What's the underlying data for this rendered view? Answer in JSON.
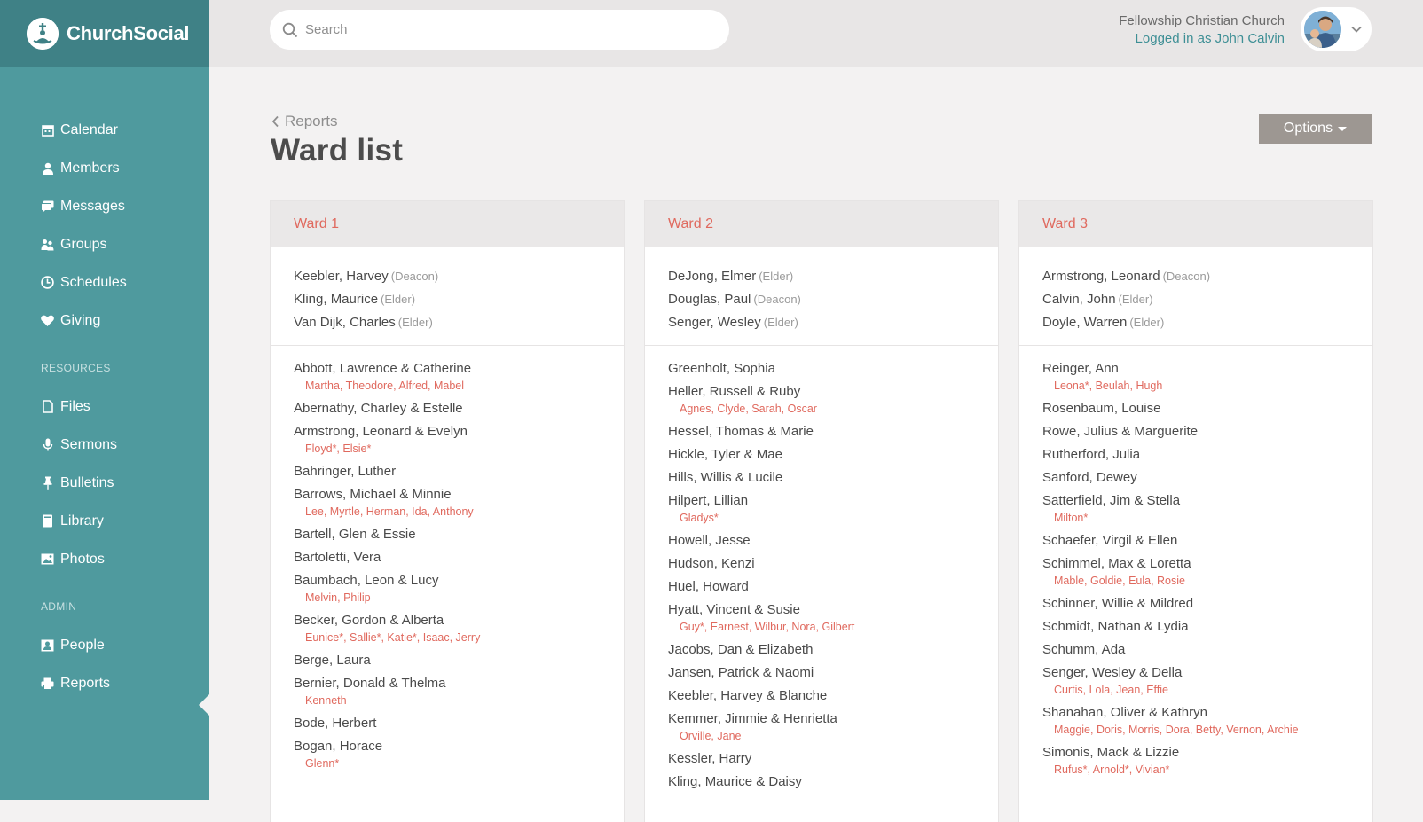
{
  "brand": {
    "name": "ChurchSocial"
  },
  "search": {
    "placeholder": "Search"
  },
  "header": {
    "church_name": "Fellowship Christian Church",
    "login_text": "Logged in as John Calvin"
  },
  "sidebar": {
    "main_items": [
      {
        "label": "Calendar",
        "icon": "calendar-icon"
      },
      {
        "label": "Members",
        "icon": "person-icon"
      },
      {
        "label": "Messages",
        "icon": "chat-icon"
      },
      {
        "label": "Groups",
        "icon": "group-icon"
      },
      {
        "label": "Schedules",
        "icon": "clock-icon"
      },
      {
        "label": "Giving",
        "icon": "heart-icon"
      }
    ],
    "resources_heading": "RESOURCES",
    "resource_items": [
      {
        "label": "Files",
        "icon": "file-icon"
      },
      {
        "label": "Sermons",
        "icon": "microphone-icon"
      },
      {
        "label": "Bulletins",
        "icon": "pin-icon"
      },
      {
        "label": "Library",
        "icon": "book-icon"
      },
      {
        "label": "Photos",
        "icon": "image-icon"
      }
    ],
    "admin_heading": "ADMIN",
    "admin_items": [
      {
        "label": "People",
        "icon": "contact-card-icon"
      },
      {
        "label": "Reports",
        "icon": "printer-icon",
        "active": true
      }
    ]
  },
  "page": {
    "back_label": "Reports",
    "title": "Ward list",
    "options_label": "Options"
  },
  "colors": {
    "accent": "#e0695e",
    "sidebar": "#4f9a9e",
    "teal_text": "#3e8f95"
  },
  "wards": [
    {
      "title": "Ward 1",
      "leaders": [
        {
          "name": "Keebler, Harvey",
          "role": "(Deacon)"
        },
        {
          "name": "Kling, Maurice",
          "role": "(Elder)"
        },
        {
          "name": "Van Dijk, Charles",
          "role": "(Elder)"
        }
      ],
      "households": [
        {
          "name": "Abbott, Lawrence & Catherine",
          "children": "Martha, Theodore, Alfred, Mabel"
        },
        {
          "name": "Abernathy, Charley & Estelle",
          "children": ""
        },
        {
          "name": "Armstrong, Leonard & Evelyn",
          "children": "Floyd*, Elsie*"
        },
        {
          "name": "Bahringer, Luther",
          "children": ""
        },
        {
          "name": "Barrows, Michael & Minnie",
          "children": "Lee, Myrtle, Herman, Ida, Anthony"
        },
        {
          "name": "Bartell, Glen & Essie",
          "children": ""
        },
        {
          "name": "Bartoletti, Vera",
          "children": ""
        },
        {
          "name": "Baumbach, Leon & Lucy",
          "children": "Melvin, Philip"
        },
        {
          "name": "Becker, Gordon & Alberta",
          "children": "Eunice*, Sallie*, Katie*, Isaac, Jerry"
        },
        {
          "name": "Berge, Laura",
          "children": ""
        },
        {
          "name": "Bernier, Donald & Thelma",
          "children": "Kenneth"
        },
        {
          "name": "Bode, Herbert",
          "children": ""
        },
        {
          "name": "Bogan, Horace",
          "children": "Glenn*"
        }
      ]
    },
    {
      "title": "Ward 2",
      "leaders": [
        {
          "name": "DeJong, Elmer",
          "role": "(Elder)"
        },
        {
          "name": "Douglas, Paul",
          "role": "(Deacon)"
        },
        {
          "name": "Senger, Wesley",
          "role": "(Elder)"
        }
      ],
      "households": [
        {
          "name": "Greenholt, Sophia",
          "children": ""
        },
        {
          "name": "Heller, Russell & Ruby",
          "children": "Agnes, Clyde, Sarah, Oscar"
        },
        {
          "name": "Hessel, Thomas & Marie",
          "children": ""
        },
        {
          "name": "Hickle, Tyler & Mae",
          "children": ""
        },
        {
          "name": "Hills, Willis & Lucile",
          "children": ""
        },
        {
          "name": "Hilpert, Lillian",
          "children": "Gladys*"
        },
        {
          "name": "Howell, Jesse",
          "children": ""
        },
        {
          "name": "Hudson, Kenzi",
          "children": ""
        },
        {
          "name": "Huel, Howard",
          "children": ""
        },
        {
          "name": "Hyatt, Vincent & Susie",
          "children": "Guy*, Earnest, Wilbur, Nora, Gilbert"
        },
        {
          "name": "Jacobs, Dan & Elizabeth",
          "children": ""
        },
        {
          "name": "Jansen, Patrick & Naomi",
          "children": ""
        },
        {
          "name": "Keebler, Harvey & Blanche",
          "children": ""
        },
        {
          "name": "Kemmer, Jimmie & Henrietta",
          "children": "Orville, Jane"
        },
        {
          "name": "Kessler, Harry",
          "children": ""
        },
        {
          "name": "Kling, Maurice & Daisy",
          "children": ""
        }
      ]
    },
    {
      "title": "Ward 3",
      "leaders": [
        {
          "name": "Armstrong, Leonard",
          "role": "(Deacon)"
        },
        {
          "name": "Calvin, John",
          "role": "(Elder)"
        },
        {
          "name": "Doyle, Warren",
          "role": "(Elder)"
        }
      ],
      "households": [
        {
          "name": "Reinger, Ann",
          "children": "Leona*, Beulah, Hugh"
        },
        {
          "name": "Rosenbaum, Louise",
          "children": ""
        },
        {
          "name": "Rowe, Julius & Marguerite",
          "children": ""
        },
        {
          "name": "Rutherford, Julia",
          "children": ""
        },
        {
          "name": "Sanford, Dewey",
          "children": ""
        },
        {
          "name": "Satterfield, Jim & Stella",
          "children": "Milton*"
        },
        {
          "name": "Schaefer, Virgil & Ellen",
          "children": ""
        },
        {
          "name": "Schimmel, Max & Loretta",
          "children": "Mable, Goldie, Eula, Rosie"
        },
        {
          "name": "Schinner, Willie & Mildred",
          "children": ""
        },
        {
          "name": "Schmidt, Nathan & Lydia",
          "children": ""
        },
        {
          "name": "Schumm, Ada",
          "children": ""
        },
        {
          "name": "Senger, Wesley & Della",
          "children": "Curtis, Lola, Jean, Effie"
        },
        {
          "name": "Shanahan, Oliver & Kathryn",
          "children": "Maggie, Doris, Morris, Dora, Betty, Vernon, Archie"
        },
        {
          "name": "Simonis, Mack & Lizzie",
          "children": "Rufus*, Arnold*, Vivian*"
        }
      ]
    }
  ]
}
